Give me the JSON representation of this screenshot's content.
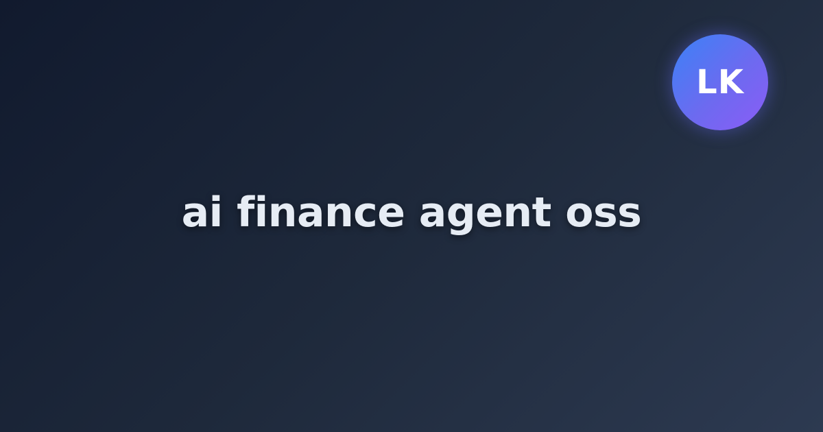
{
  "card": {
    "title": "ai finance agent oss",
    "avatar": {
      "initials": "LK"
    }
  },
  "colors": {
    "background_start": "#111a2e",
    "background_end": "#2d3a51",
    "title_text": "#e6ecf4",
    "avatar_gradient_start": "#3b82f6",
    "avatar_gradient_end": "#8b5cf6",
    "avatar_text": "#ffffff"
  }
}
